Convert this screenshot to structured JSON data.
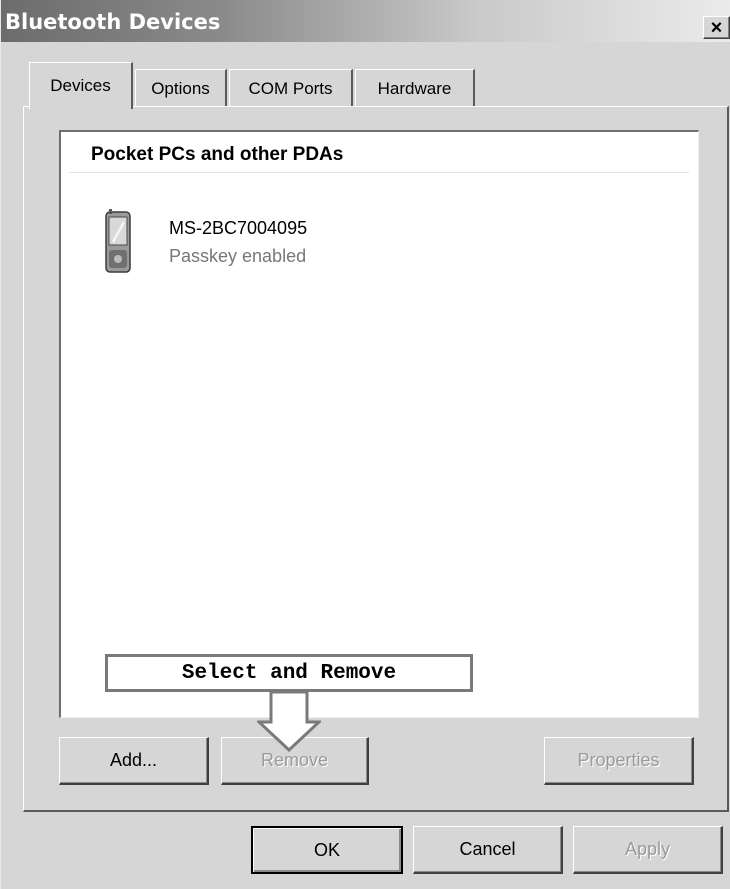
{
  "window": {
    "title": "Bluetooth Devices",
    "close_glyph": "×"
  },
  "tabs": [
    {
      "label": "Devices",
      "active": true
    },
    {
      "label": "Options",
      "active": false
    },
    {
      "label": "COM Ports",
      "active": false
    },
    {
      "label": "Hardware",
      "active": false
    }
  ],
  "device_list": {
    "group_header": "Pocket PCs and other PDAs",
    "devices": [
      {
        "name": "MS-2BC7004095",
        "status": "Passkey enabled",
        "icon": "pda-icon"
      }
    ]
  },
  "annotation": {
    "callout_text": "Select and Remove"
  },
  "panel_buttons": {
    "add": "Add...",
    "remove": "Remove",
    "properties": "Properties"
  },
  "dialog_buttons": {
    "ok": "OK",
    "cancel": "Cancel",
    "apply": "Apply"
  },
  "colors": {
    "dialog_background": "#d6d6d6",
    "list_background": "#ffffff",
    "disabled_text": "#9a9a9a"
  }
}
